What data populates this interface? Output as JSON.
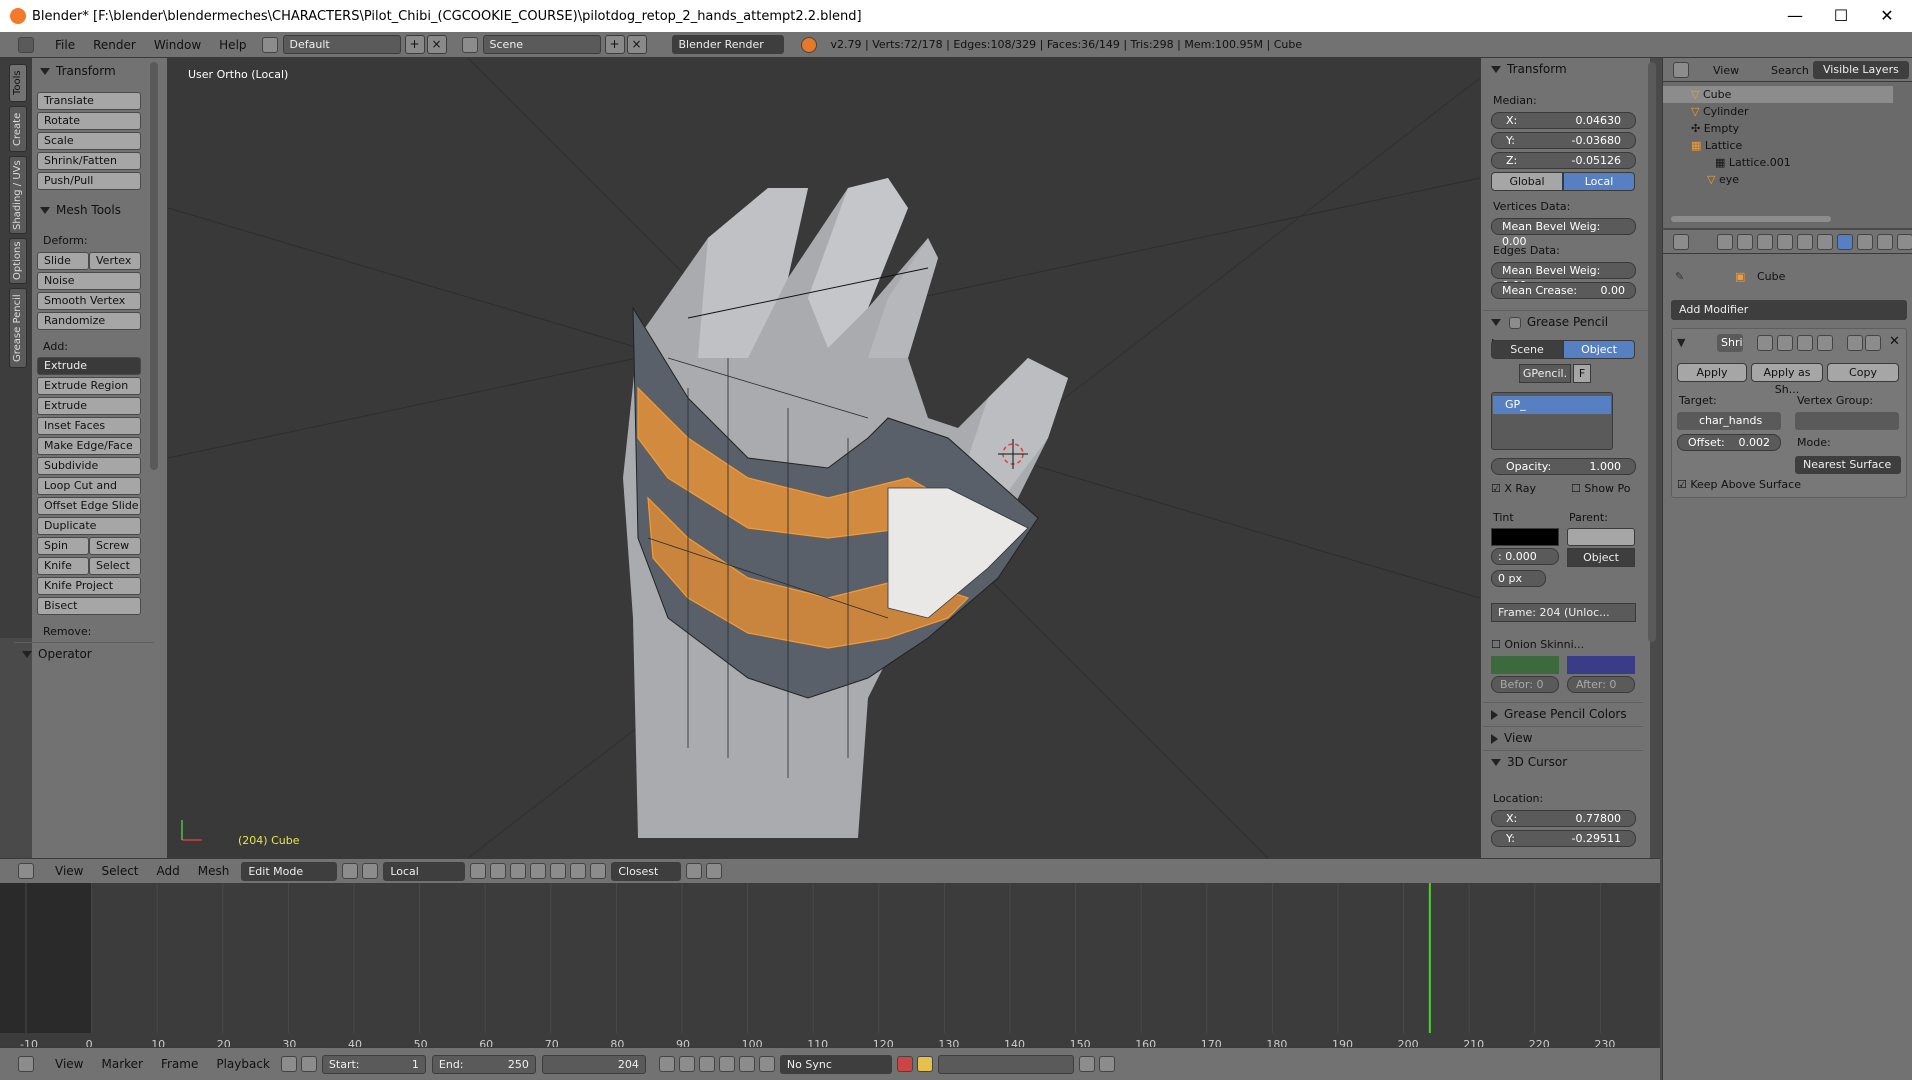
{
  "window": {
    "title": "Blender* [F:\\blender\\blendermeches\\CHARACTERS\\Pilot_Chibi_(CGCOOKIE_COURSE)\\pilotdog_retop_2_hands_attempt2.2.blend]",
    "minimize": "—",
    "maximize": "☐",
    "close": "✕"
  },
  "topbar": {
    "menus": [
      "File",
      "Render",
      "Window",
      "Help"
    ],
    "layout": "Default",
    "scene": "Scene",
    "engine": "Blender Render",
    "stats": "v2.79 | Verts:72/178 | Edges:108/329 | Faces:36/149 | Tris:298 | Mem:100.95M | Cube"
  },
  "vtabs": [
    "Tools",
    "Create",
    "Shading / UVs",
    "Options",
    "Grease Pencil"
  ],
  "toolshelf": {
    "transform_header": "Transform",
    "transform": [
      "Translate",
      "Rotate",
      "Scale",
      "Shrink/Fatten",
      "Push/Pull"
    ],
    "meshtools_header": "Mesh Tools",
    "deform_label": "Deform:",
    "slide_edge": "Slide Ed",
    "vertex": "Vertex",
    "noise": "Noise",
    "smooth_vertex": "Smooth Vertex",
    "randomize": "Randomize",
    "add_label": "Add:",
    "extrude": "Extrude",
    "add_tools": [
      "Extrude Region",
      "Extrude Individual",
      "Inset Faces",
      "Make Edge/Face",
      "Subdivide",
      "Loop Cut and Slide",
      "Offset Edge Slide",
      "Duplicate"
    ],
    "spin": "Spin",
    "screw": "Screw",
    "knife": "Knife",
    "select": "Select",
    "knife_project": "Knife Project",
    "bisect": "Bisect",
    "remove_label": "Remove:",
    "operator_header": "Operator"
  },
  "viewport": {
    "view_label": "User Ortho (Local)",
    "object_label": "(204) Cube"
  },
  "npanel": {
    "transform_header": "Transform",
    "median_label": "Median:",
    "median": [
      {
        "k": "X:",
        "v": "0.04630"
      },
      {
        "k": "Y:",
        "v": "-0.03680"
      },
      {
        "k": "Z:",
        "v": "-0.05126"
      }
    ],
    "global": "Global",
    "local": "Local",
    "vertices_data": "Vertices Data:",
    "mean_bevel_v": "Mean Bevel Weig: 0.00",
    "edges_data": "Edges Data:",
    "mean_bevel_e": "Mean Bevel Weig: 0.00",
    "mean_crease": "Mean Crease:",
    "mean_crease_val": "0.00",
    "gp_layers_header": "Grease Pencil Layers",
    "scene": "Scene",
    "object": "Object",
    "gpencil": "GPencil.",
    "f": "F",
    "gp_layer": "GP_",
    "opacity": "Opacity:",
    "opacity_val": "1.000",
    "xray": "X Ray",
    "show_po": "Show Po",
    "tint": "Tint",
    "parent": "Parent:",
    "tint_val": ": 0.000",
    "parent_val": "Object",
    "px": "0 px",
    "frame": "Frame: 204 (Unloc...",
    "onion": "Onion Skinni...",
    "before": "Befor: 0",
    "after": "After: 0",
    "gp_colors": "Grease Pencil Colors",
    "view": "View",
    "cursor_header": "3D Cursor",
    "location": "Location:",
    "cursor": [
      {
        "k": "X:",
        "v": "0.77800"
      },
      {
        "k": "Y:",
        "v": "-0.29511"
      }
    ]
  },
  "outliner": {
    "view": "View",
    "search": "Search",
    "layers": "Visible Layers",
    "items": [
      "Cube",
      "Cylinder",
      "Empty",
      "Lattice",
      "Lattice.001",
      "eye"
    ]
  },
  "props": {
    "object_name": "Cube",
    "add_modifier": "Add Modifier",
    "modifier_name": "Shri",
    "apply": "Apply",
    "apply_as": "Apply as Sh...",
    "copy": "Copy",
    "target_label": "Target:",
    "vgroup_label": "Vertex Group:",
    "target": "char_hands",
    "offset": "Offset:",
    "offset_val": "0.002",
    "mode_label": "Mode:",
    "mode": "Nearest Surface",
    "keep_above": "Keep Above Surface"
  },
  "vheader": {
    "menus": [
      "View",
      "Select",
      "Add",
      "Mesh"
    ],
    "mode": "Edit Mode",
    "pivot": "Local",
    "snap": "Closest"
  },
  "timeline": {
    "ticks": [
      "-10",
      "0",
      "10",
      "20",
      "30",
      "40",
      "50",
      "60",
      "70",
      "80",
      "90",
      "100",
      "110",
      "120",
      "130",
      "140",
      "150",
      "160",
      "170",
      "180",
      "190",
      "200",
      "210",
      "220",
      "230"
    ],
    "current_frame": 204,
    "menus": [
      "View",
      "Marker",
      "Frame",
      "Playback"
    ],
    "start": "Start:",
    "start_val": "1",
    "end": "End:",
    "end_val": "250",
    "frame_val": "204",
    "sync": "No Sync"
  },
  "colors": {
    "selection": "#f39c34",
    "active_blue": "#5680c2",
    "playhead": "#44d61d"
  }
}
